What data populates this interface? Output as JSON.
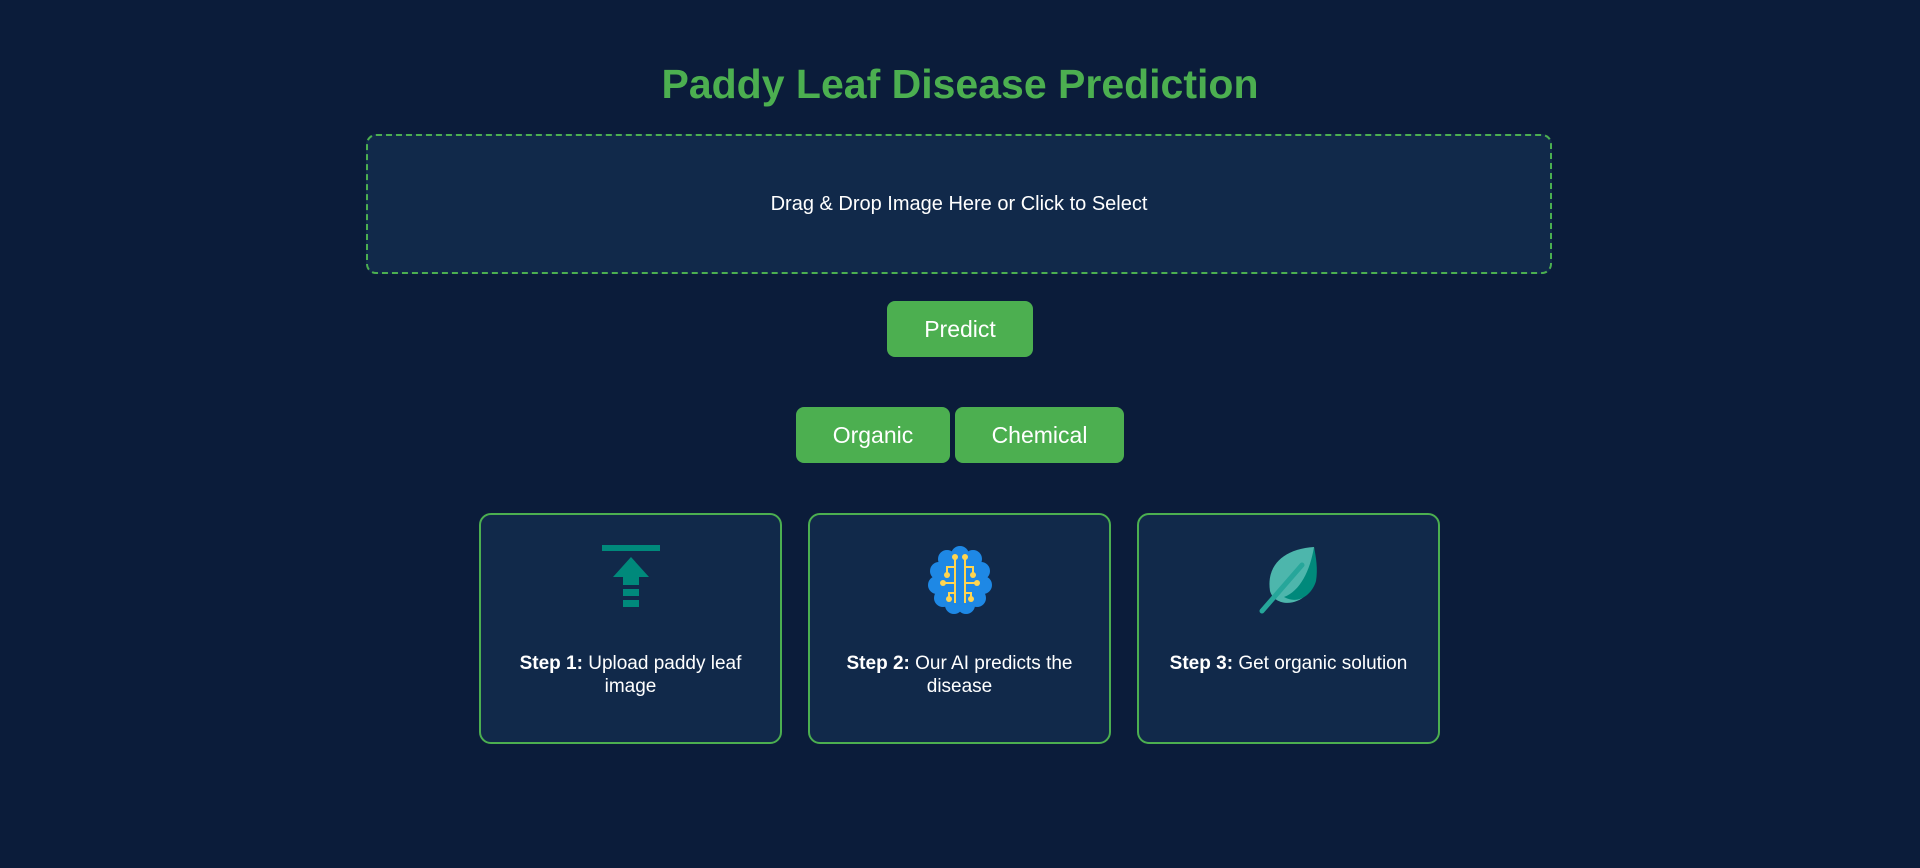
{
  "header": {
    "title": "Paddy Leaf Disease Prediction"
  },
  "upload": {
    "dropzone_text": "Drag & Drop Image Here or Click to Select"
  },
  "actions": {
    "predict_label": "Predict",
    "organic_label": "Organic",
    "chemical_label": "Chemical"
  },
  "steps": [
    {
      "label": "Step 1:",
      "text": "Upload paddy leaf image",
      "icon": "upload-icon"
    },
    {
      "label": "Step 2:",
      "text": "Our AI predicts the disease",
      "icon": "ai-brain-icon"
    },
    {
      "label": "Step 3:",
      "text": "Get organic solution",
      "icon": "leaf-icon"
    }
  ],
  "colors": {
    "background": "#0b1c3a",
    "panel": "#11294a",
    "accent": "#4caf50",
    "teal_icon": "#00897b"
  }
}
